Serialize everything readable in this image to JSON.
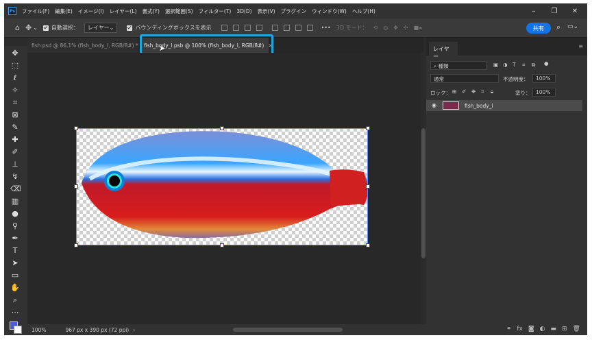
{
  "menubar": {
    "logo": "Ps",
    "items": [
      "ファイル(F)",
      "編集(E)",
      "イメージ(I)",
      "レイヤー(L)",
      "書式(Y)",
      "選択範囲(S)",
      "フィルター(T)",
      "3D(D)",
      "表示(V)",
      "プラグイン",
      "ウィンドウ(W)",
      "ヘルプ(H)"
    ],
    "window_controls": [
      "minimize-icon",
      "restore-icon",
      "close-icon"
    ]
  },
  "options": {
    "auto_select_label": "自動選択：",
    "auto_select_value": "レイヤー",
    "bounding_box_label": "バウンディングボックスを表示",
    "more": "•••",
    "mode_3d": "3D モード：",
    "share_label": "共有"
  },
  "tabs": [
    {
      "label": "fish.psd @ 86.1% (fish_body_l, RGB/8#) *",
      "close": "×",
      "active": false
    },
    {
      "label": "fish_body_l.psb @ 100% (fish_body_l, RGB/8#)",
      "close": "×",
      "active": true
    }
  ],
  "status": {
    "zoom": "100%",
    "dimensions": "967 px x 390 px (72 ppi)"
  },
  "layers_panel": {
    "tab_label": "レイヤー",
    "filter_label": "種類",
    "blend_mode": "通常",
    "opacity_label": "不透明度：",
    "opacity_value": "100%",
    "lock_label": "ロック：",
    "fill_label": "塗り：",
    "fill_value": "100%",
    "layers": [
      {
        "name": "fish_body_l",
        "visible": true
      }
    ]
  },
  "colors": {
    "highlight": "#1aa7e0",
    "share_button": "#1473e6",
    "foreground": "#4a5bd6",
    "background": "#ffffff"
  }
}
